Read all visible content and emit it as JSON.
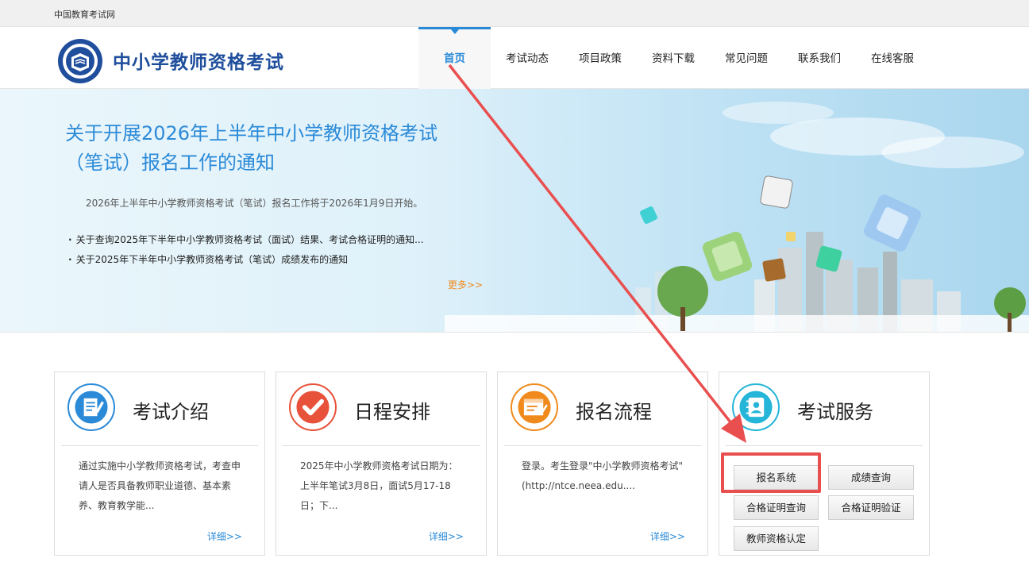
{
  "topbar": {
    "site_link": "中国教育考试网"
  },
  "header": {
    "logo_title": "中小学教师资格考试",
    "nav": [
      {
        "label": "首页",
        "active": true
      },
      {
        "label": "考试动态"
      },
      {
        "label": "项目政策"
      },
      {
        "label": "资料下载"
      },
      {
        "label": "常见问题"
      },
      {
        "label": "联系我们"
      },
      {
        "label": "在线客服"
      }
    ]
  },
  "banner": {
    "title": "关于开展2026年上半年中小学教师资格考试（笔试）报名工作的通知",
    "summary": "2026年上半年中小学教师资格考试（笔试）报名工作将于2026年1月9日开始。",
    "news": [
      "关于查询2025年下半年中小学教师资格考试（面试）结果、考试合格证明的通知...",
      "关于2025年下半年中小学教师资格考试（笔试）成绩发布的通知"
    ],
    "more": "更多>>"
  },
  "cards": [
    {
      "title": "考试介绍",
      "icon": "edit-document-icon",
      "color": "#2b8ad8",
      "body": "通过实施中小学教师资格考试，考查申请人是否具备教师职业道德、基本素养、教育教学能...",
      "more": "详细>>"
    },
    {
      "title": "日程安排",
      "icon": "checkmark-icon",
      "color": "#e8523a",
      "body": "2025年中小学教师资格考试日期为：上半年笔试3月8日，面试5月17-18日；下...",
      "more": "详细>>"
    },
    {
      "title": "报名流程",
      "icon": "registration-form-icon",
      "color": "#f08a1c",
      "body": "登录。考生登录\"中小学教师资格考试\"(http://ntce.neea.edu....",
      "more": "详细>>"
    },
    {
      "title": "考试服务",
      "icon": "address-book-icon",
      "color": "#25b5d8"
    }
  ],
  "services": {
    "register": "报名系统",
    "score_query": "成绩查询",
    "certificate_query": "合格证明查询",
    "certificate_verify": "合格证明验证",
    "teacher_certification": "教师资格认定"
  },
  "colors": {
    "accent": "#2b8ad8",
    "annotation": "#e94f4f",
    "more_link": "#f08a1c"
  }
}
